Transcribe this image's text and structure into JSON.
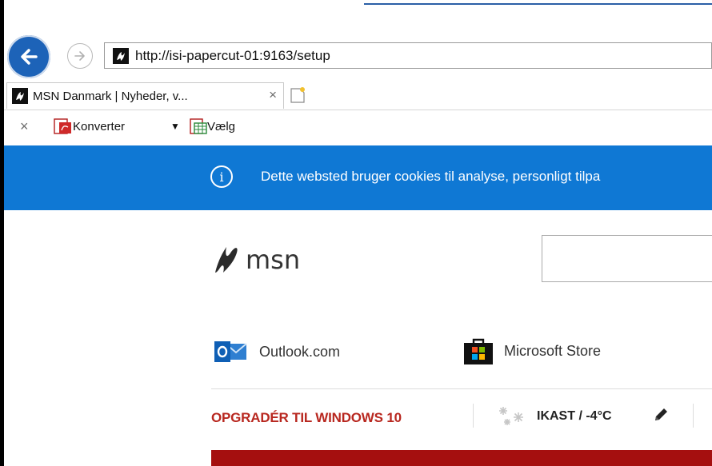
{
  "browser": {
    "address_url": "http://isi-papercut-01:9163/setup",
    "tab_title": "MSN Danmark | Nyheder, v...",
    "tab_close_symbol": "×"
  },
  "command_bar": {
    "stop_symbol": "×",
    "convert_label": "Konverter",
    "dropdown_symbol": "▼",
    "select_label": "Vælg"
  },
  "cookie_banner": {
    "info_symbol": "i",
    "text": "Dette websted bruger cookies til analyse, personligt tilpa",
    "background_color": "#0f78d4"
  },
  "msn": {
    "logo_text": "msn",
    "quick_links": [
      {
        "label": "Outlook.com",
        "icon": "outlook-icon"
      },
      {
        "label": "Microsoft Store",
        "icon": "microsoft-store-icon"
      }
    ],
    "upgrade_text": "OPGRADÉR TIL WINDOWS 10",
    "weather_text": "IKAST / -4°C",
    "upgrade_color": "#b8271f"
  }
}
